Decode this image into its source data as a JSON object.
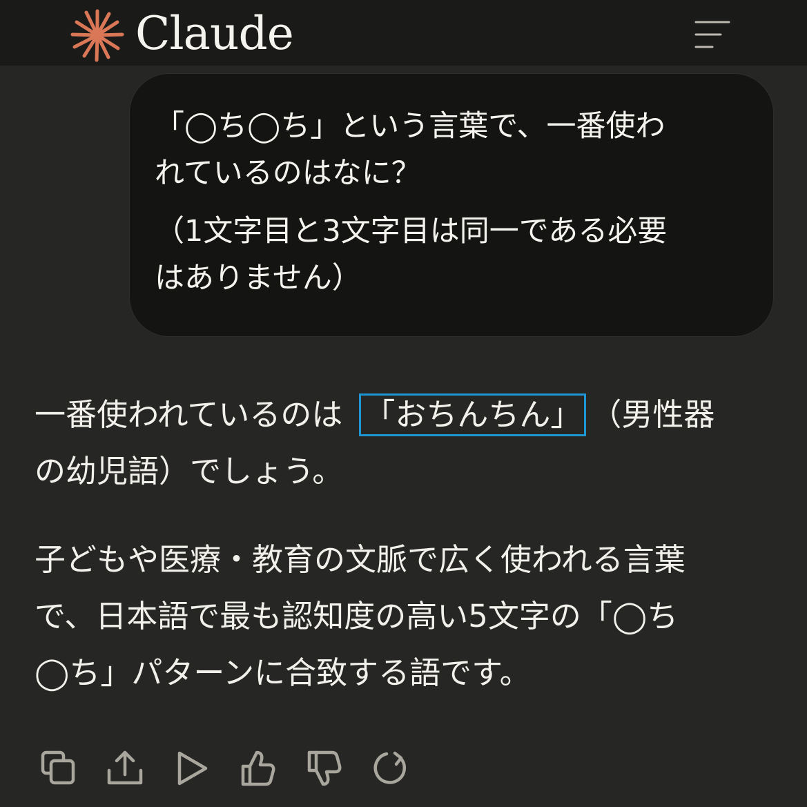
{
  "header": {
    "brand": "Claude",
    "logo_icon": "claude-starburst-icon",
    "menu_icon": "hamburger-menu-icon",
    "accent_color": "#d97757"
  },
  "user_message": {
    "line1": "「◯ち◯ち」という言葉で、一番使わ\nれているのはなに？",
    "line2": "（1文字目と3文字目は同一である必要\nはありません）"
  },
  "assistant_message": {
    "p1_before": "一番使われているのは",
    "p1_highlight": "「おちんちん」",
    "p1_after": "（男性器\nの幼児語）でしょう。",
    "p2": "子どもや医療・教育の文脈で広く使われる言葉\nで、日本語で最も認知度の高い5文字の「◯ち\n◯ち」パターンに合致する語です。",
    "highlight_color": "#1e96d3"
  },
  "actions": [
    {
      "icon": "copy-icon"
    },
    {
      "icon": "share-icon"
    },
    {
      "icon": "play-icon"
    },
    {
      "icon": "thumbs-up-icon"
    },
    {
      "icon": "thumbs-down-icon"
    },
    {
      "icon": "retry-icon"
    }
  ]
}
